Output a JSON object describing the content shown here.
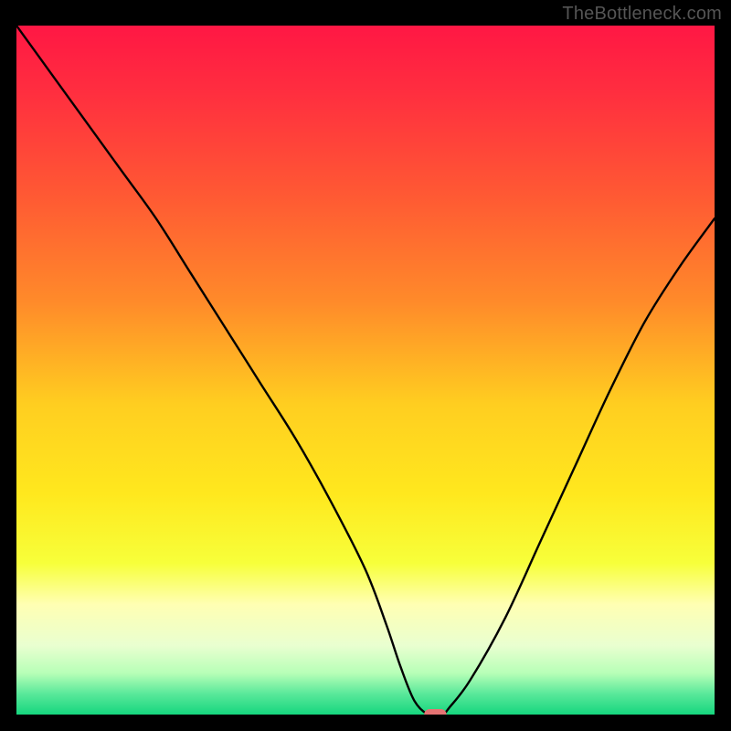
{
  "watermark": "TheBottleneck.com",
  "chart_data": {
    "type": "line",
    "title": "",
    "xlabel": "",
    "ylabel": "",
    "xlim": [
      0,
      100
    ],
    "ylim": [
      0,
      100
    ],
    "legend": false,
    "background_gradient_stops": [
      {
        "offset": 0.0,
        "color": "#ff1744"
      },
      {
        "offset": 0.1,
        "color": "#ff2f3f"
      },
      {
        "offset": 0.25,
        "color": "#ff5a33"
      },
      {
        "offset": 0.4,
        "color": "#ff8a2a"
      },
      {
        "offset": 0.55,
        "color": "#ffce20"
      },
      {
        "offset": 0.68,
        "color": "#ffe81e"
      },
      {
        "offset": 0.78,
        "color": "#f7ff3a"
      },
      {
        "offset": 0.84,
        "color": "#ffffb3"
      },
      {
        "offset": 0.9,
        "color": "#e9ffd0"
      },
      {
        "offset": 0.94,
        "color": "#b7ffb7"
      },
      {
        "offset": 0.97,
        "color": "#59e89a"
      },
      {
        "offset": 1.0,
        "color": "#15d67e"
      }
    ],
    "series": [
      {
        "name": "bottleneck-curve",
        "color": "#000000",
        "x": [
          0,
          5,
          10,
          15,
          20,
          25,
          30,
          35,
          40,
          45,
          50,
          53,
          55,
          57,
          59,
          61,
          62,
          65,
          70,
          75,
          80,
          85,
          90,
          95,
          100
        ],
        "y": [
          100,
          93,
          86,
          79,
          72,
          64,
          56,
          48,
          40,
          31,
          21,
          13,
          7,
          2,
          0,
          0,
          1,
          5,
          14,
          25,
          36,
          47,
          57,
          65,
          72
        ]
      }
    ],
    "marker": {
      "name": "optimal-marker",
      "color": "#e57373",
      "x": 60,
      "y": 0,
      "width": 3.2,
      "height": 1.6
    }
  }
}
